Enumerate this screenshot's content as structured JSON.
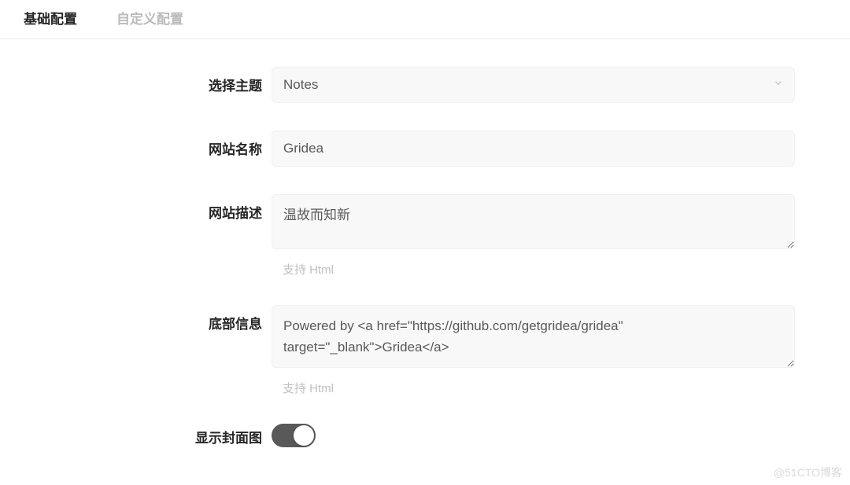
{
  "tabs": {
    "basic": "基础配置",
    "custom": "自定义配置"
  },
  "form": {
    "theme": {
      "label": "选择主题",
      "value": "Notes"
    },
    "siteName": {
      "label": "网站名称",
      "value": "Gridea"
    },
    "siteDescription": {
      "label": "网站描述",
      "value": "温故而知新",
      "helper": "支持 Html"
    },
    "footerInfo": {
      "label": "底部信息",
      "value": "Powered by <a href=\"https://github.com/getgridea/gridea\" target=\"_blank\">Gridea</a>",
      "helper": "支持 Html"
    },
    "showCover": {
      "label": "显示封面图",
      "value": true
    }
  },
  "watermark": "@51CTO博客"
}
